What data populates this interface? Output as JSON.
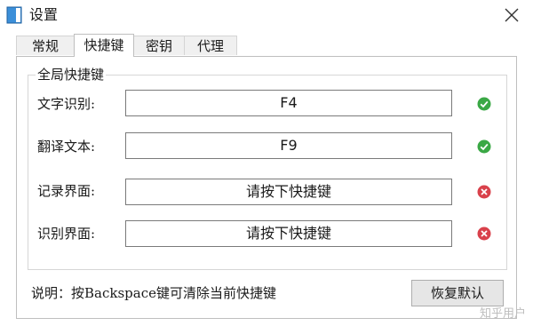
{
  "window": {
    "title": "设置"
  },
  "tabs": [
    {
      "label": "常规",
      "active": false
    },
    {
      "label": "快捷键",
      "active": true
    },
    {
      "label": "密钥",
      "active": false
    },
    {
      "label": "代理",
      "active": false
    }
  ],
  "group": {
    "title": "全局快捷键",
    "rows": [
      {
        "label": "文字识别:",
        "value": "F4",
        "status": "ok"
      },
      {
        "label": "翻译文本:",
        "value": "F9",
        "status": "ok"
      },
      {
        "label": "记录界面:",
        "value": "请按下快捷键",
        "status": "error"
      },
      {
        "label": "识别界面:",
        "value": "请按下快捷键",
        "status": "error"
      }
    ]
  },
  "hint": "说明：按Backspace键可清除当前快捷键",
  "reset_label": "恢复默认",
  "watermark": "知乎用户",
  "colors": {
    "ok": "#3aa845",
    "error": "#d9414b"
  },
  "icons": {
    "app": "app-icon",
    "close": "close-icon",
    "ok": "check-circle-icon",
    "error": "cross-circle-icon"
  }
}
